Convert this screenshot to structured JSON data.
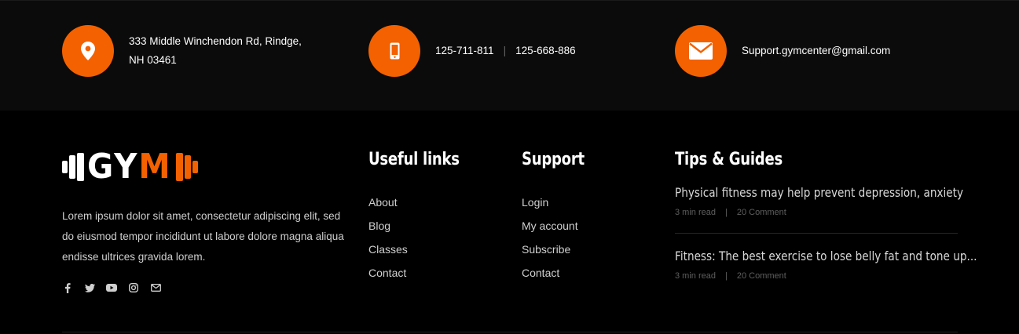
{
  "contact": {
    "address_line1": "333 Middle Winchendon Rd, Rindge,",
    "address_line2": "NH 03461",
    "phone1": "125-711-811",
    "phone_separator": "|",
    "phone2": "125-668-886",
    "email": "Support.gymcenter@gmail.com",
    "accent_color": "#f36100"
  },
  "logo": {
    "text_main": "GY",
    "text_accent": "M"
  },
  "about_text": "Lorem ipsum dolor sit amet, consectetur adipiscing elit, sed do eiusmod tempor incididunt ut labore dolore magna aliqua endisse ultrices gravida lorem.",
  "socials": [
    "facebook-icon",
    "twitter-icon",
    "youtube-icon",
    "instagram-icon",
    "mail-icon"
  ],
  "useful_links": {
    "title": "Useful links",
    "items": [
      "About",
      "Blog",
      "Classes",
      "Contact"
    ]
  },
  "support": {
    "title": "Support",
    "items": [
      "Login",
      "My account",
      "Subscribe",
      "Contact"
    ]
  },
  "tips": {
    "title": "Tips & Guides",
    "posts": [
      {
        "title": "Physical fitness may help prevent depression, anxiety",
        "read": "3 min read",
        "sep": "|",
        "comments": "20 Comment"
      },
      {
        "title": "Fitness: The best exercise to lose belly fat and tone up...",
        "read": "3 min read",
        "sep": "|",
        "comments": "20 Comment"
      }
    ]
  }
}
